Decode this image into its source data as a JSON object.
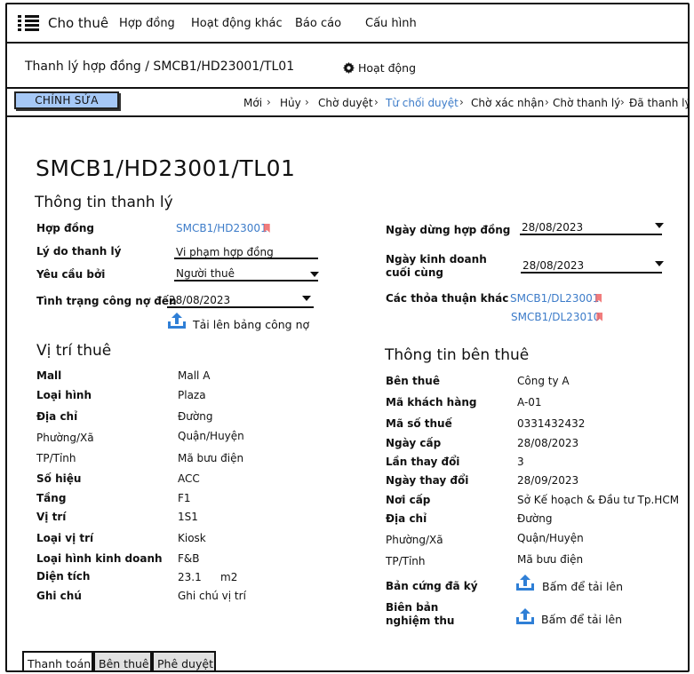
{
  "nav": {
    "app_title": "Cho thuê",
    "items": [
      "Hợp đồng",
      "Hoạt động khác",
      "Báo cáo",
      "Cấu hình"
    ]
  },
  "header": {
    "breadcrumb": "Thanh lý hợp đồng / SMCB1/HD23001/TL01",
    "activity_label": "Hoạt động"
  },
  "toolbar": {
    "edit_label": "CHỈNH SỬA",
    "stages": [
      "Mới",
      "Hủy",
      "Chờ duyệt",
      "Từ chối duyệt",
      "Chờ xác nhận",
      "Chờ thanh lý",
      "Đã thanh lý"
    ],
    "active_stage": "Từ chối duyệt"
  },
  "doc": {
    "title": "SMCB1/HD23001/TL01",
    "section_liquidation": "Thông tin thanh lý",
    "section_location": "Vị trí thuê",
    "section_tenant": "Thông tin bên thuê"
  },
  "liquidation": {
    "contract_label": "Hợp đồng",
    "contract_value": "SMCB1/HD23001",
    "reason_label": "Lý do thanh lý",
    "reason_value": "Vi phạm hợp đồng",
    "requested_by_label": "Yêu cầu bởi",
    "requested_by_value": "Người thuê",
    "debt_status_label": "Tình trạng công nợ đến",
    "debt_status_value": "28/08/2023",
    "upload_debt_label": "Tải lên bảng công nợ",
    "stop_date_label": "Ngày dừng hợp đồng",
    "stop_date_value": "28/08/2023",
    "last_business_label_1": "Ngày kinh doanh",
    "last_business_label_2": "cuối cùng",
    "last_business_value": "28/08/2023",
    "other_agreements_label": "Các thỏa thuận khác",
    "other_agreements": [
      "SMCB1/DL23001",
      "SMCB1/DL23010"
    ]
  },
  "location": {
    "rows": [
      {
        "label": "Mall",
        "value": "Mall A"
      },
      {
        "label": "Loại hình",
        "value": "Plaza"
      },
      {
        "label": "Địa chỉ",
        "value": "Đường"
      },
      {
        "label": "Phường/Xã",
        "value": "Quận/Huyện"
      },
      {
        "label": "TP/Tỉnh",
        "value": "Mã bưu điện"
      },
      {
        "label": "Số hiệu",
        "value": "ACC"
      },
      {
        "label": "Tầng",
        "value": "F1"
      },
      {
        "label": "Vị trí",
        "value": "1S1"
      },
      {
        "label": "Loại vị trí",
        "value": "Kiosk"
      },
      {
        "label": "Loại hình kinh doanh",
        "value": "F&B"
      },
      {
        "label": "Diện tích",
        "value": "23.1"
      },
      {
        "label": "Ghi chú",
        "value": "Ghi chú vị trí"
      }
    ],
    "area_unit": "m2"
  },
  "tenant": {
    "rows": [
      {
        "label": "Bên thuê",
        "value": "Công ty A"
      },
      {
        "label": "Mã khách hàng",
        "value": "A-01"
      },
      {
        "label": "Mã số thuế",
        "value": "0331432432"
      },
      {
        "label": "Ngày cấp",
        "value": "28/08/2023"
      },
      {
        "label": "Lần thay đổi",
        "value": "3"
      },
      {
        "label": "Ngày thay đổi",
        "value": "28/09/2023"
      },
      {
        "label": "Nơi cấp",
        "value": "Sở Kế hoạch & Đầu tư Tp.HCM"
      },
      {
        "label": "Địa chỉ",
        "value": "Đường"
      },
      {
        "label": "Phường/Xã",
        "value": "Quận/Huyện"
      },
      {
        "label": "TP/Tỉnh",
        "value": "Mã bưu điện"
      }
    ],
    "signed_copy_label": "Bản cứng đã ký",
    "acceptance_label_1": "Biên bản",
    "acceptance_label_2": "nghiệm thu",
    "upload_label": "Bấm để tải lên"
  },
  "tabs": [
    "Thanh toán",
    "Bên thuê",
    "Phê duyệt"
  ],
  "colors": {
    "link": "#3d7cc9",
    "edit_button": "#a6c8f6",
    "upload_icon": "#2f7fd6",
    "flag": "#e66666"
  }
}
